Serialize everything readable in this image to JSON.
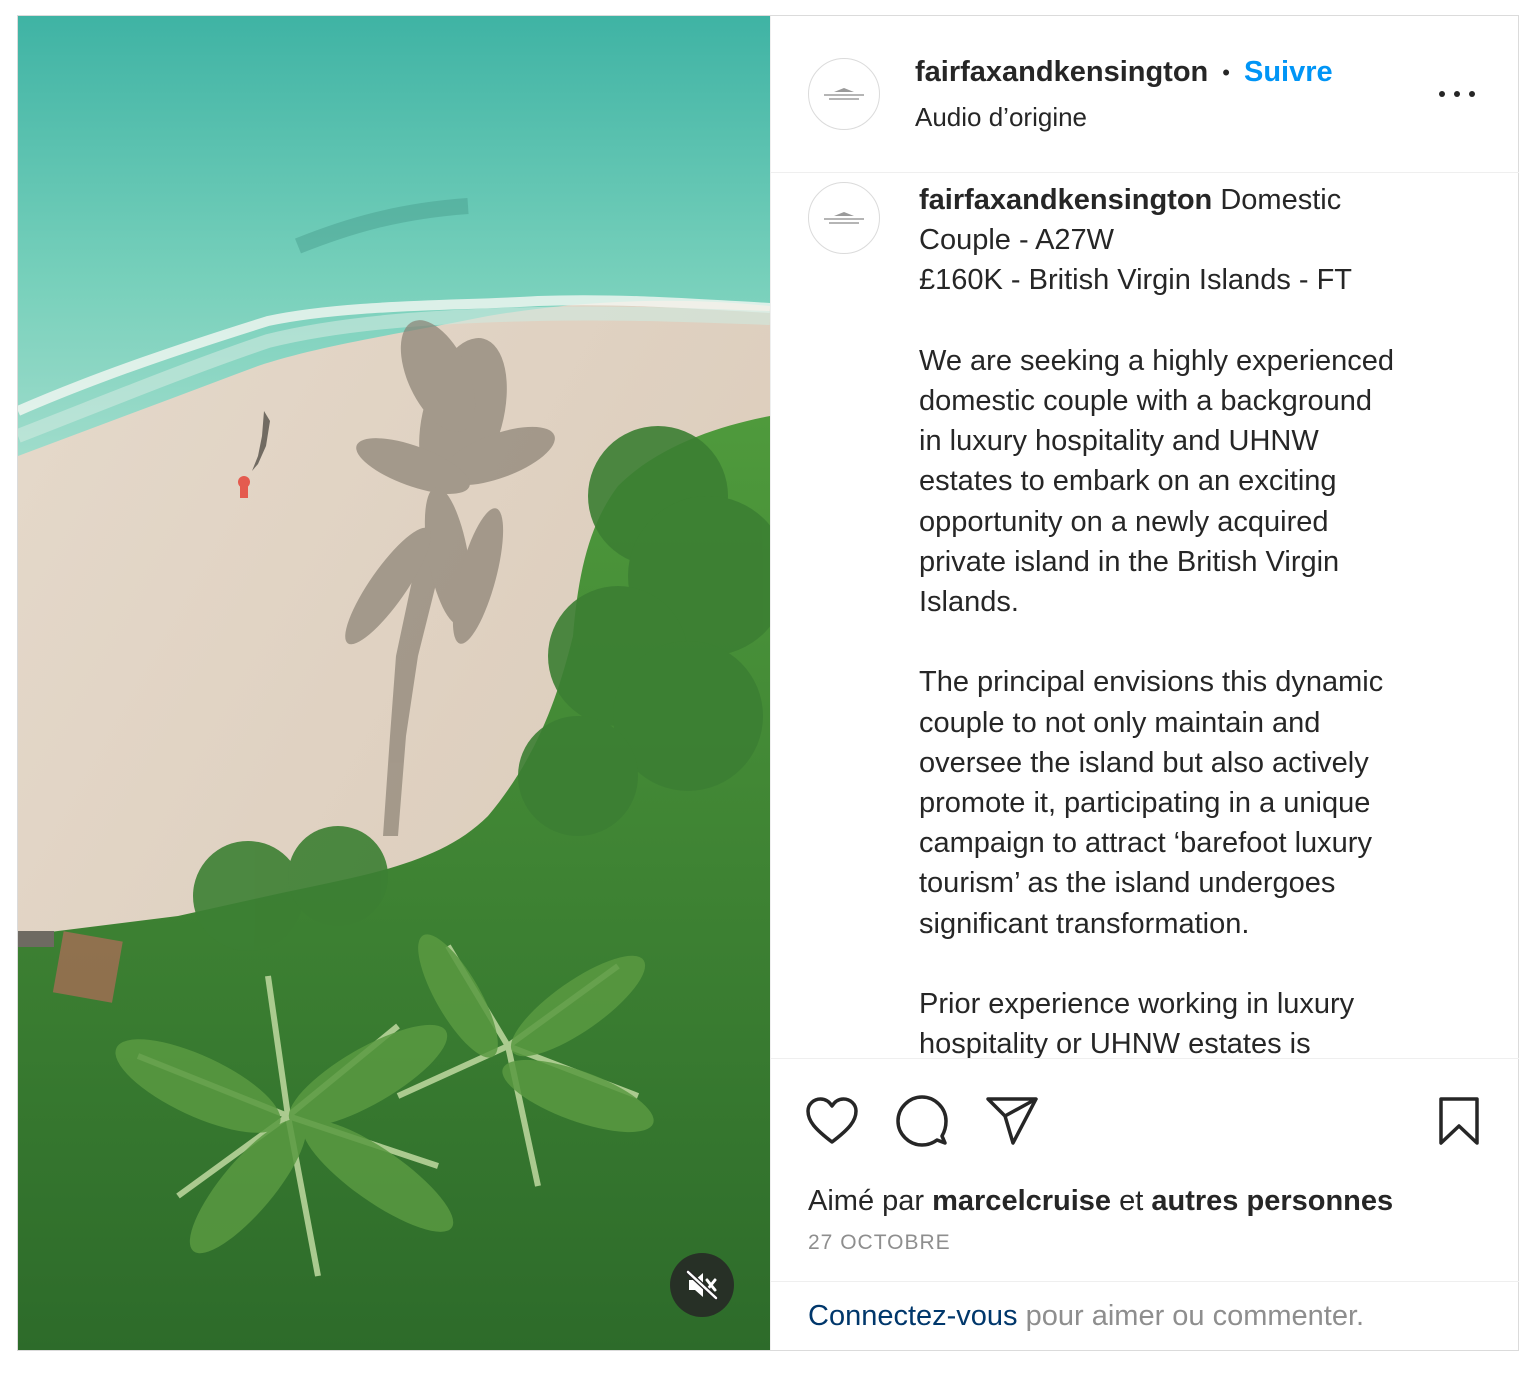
{
  "header": {
    "username": "fairfaxandkensington",
    "separator": "•",
    "follow_label": "Suivre",
    "audio_label": "Audio d’origine",
    "more_icon": "more-horizontal-icon"
  },
  "caption": {
    "username": "fairfaxandkensington",
    "lines": [
      "Domestic",
      "Couple - A27W",
      "£160K - British Virgin Islands - FT"
    ],
    "paragraph1": [
      "We are seeking a highly experienced",
      "domestic couple with a background",
      "in luxury hospitality and UHNW",
      "estates to embark on an exciting",
      "opportunity on a newly acquired",
      "private island in the British Virgin",
      "Islands."
    ],
    "paragraph2": [
      "The principal envisions this dynamic",
      "couple to not only maintain and",
      "oversee the island but also actively",
      "promote it, participating in a unique",
      "campaign to attract ‘barefoot luxury",
      "tourism’ as the island undergoes",
      "significant transformation."
    ],
    "paragraph3": [
      "Prior experience working in luxury",
      "hospitality or UHNW estates is"
    ]
  },
  "actions": {
    "icons": [
      "heart-icon",
      "comment-icon",
      "share-icon",
      "bookmark-icon"
    ]
  },
  "likes": {
    "prefix": "Aimé par",
    "user": "marcelcruise",
    "connector": "et",
    "others": "autres personnes"
  },
  "date": "27 OCTOBRE",
  "login_prompt": {
    "link": "Connectez-vous",
    "rest": "pour aimer ou commenter."
  },
  "media": {
    "mute_icon": "speaker-muted-icon"
  }
}
